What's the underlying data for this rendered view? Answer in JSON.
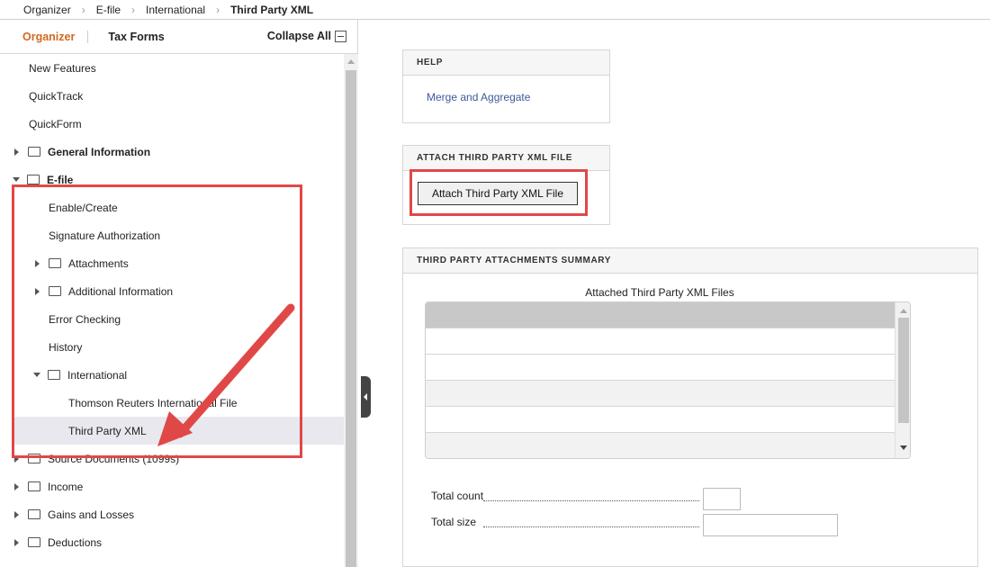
{
  "breadcrumb": {
    "items": [
      "Organizer",
      "E-file",
      "International",
      "Third Party XML"
    ],
    "separator": "›"
  },
  "left_panel": {
    "tabs": {
      "organizer": "Organizer",
      "tax_forms": "Tax Forms"
    },
    "collapse_all": "Collapse All",
    "tree": [
      {
        "label": "New Features",
        "type": "leaf"
      },
      {
        "label": "QuickTrack",
        "type": "leaf"
      },
      {
        "label": "QuickForm",
        "type": "leaf"
      },
      {
        "label": "General Information",
        "type": "folder-collapsed",
        "bold": true
      },
      {
        "label": "E-file",
        "type": "folder-expanded",
        "bold": true
      },
      {
        "label": "Enable/Create",
        "type": "leaf"
      },
      {
        "label": "Signature Authorization",
        "type": "leaf"
      },
      {
        "label": "Attachments",
        "type": "folder-collapsed"
      },
      {
        "label": "Additional Information",
        "type": "folder-collapsed"
      },
      {
        "label": "Error Checking",
        "type": "leaf"
      },
      {
        "label": "History",
        "type": "leaf"
      },
      {
        "label": "International",
        "type": "folder-expanded"
      },
      {
        "label": "Thomson Reuters International File",
        "type": "leaf"
      },
      {
        "label": "Third Party XML",
        "type": "leaf",
        "selected": true
      },
      {
        "label": "Source Documents (1099s)",
        "type": "folder-collapsed"
      },
      {
        "label": "Income",
        "type": "folder-collapsed"
      },
      {
        "label": "Gains and Losses",
        "type": "folder-collapsed"
      },
      {
        "label": "Deductions",
        "type": "folder-collapsed"
      }
    ]
  },
  "help": {
    "header": "HELP",
    "link": "Merge and Aggregate"
  },
  "attach": {
    "header": "ATTACH THIRD PARTY XML FILE",
    "button": "Attach Third Party XML File"
  },
  "summary": {
    "header": "THIRD PARTY ATTACHMENTS SUMMARY",
    "grid_title": "Attached Third Party XML Files",
    "total_count_label": "Total count",
    "total_size_label": "Total size",
    "total_count_value": "",
    "total_size_value": ""
  },
  "colors": {
    "accent_tab": "#d2691e",
    "link": "#3d5a9a",
    "annotation": "#e04848",
    "selected_row": "#e8e8ee"
  }
}
